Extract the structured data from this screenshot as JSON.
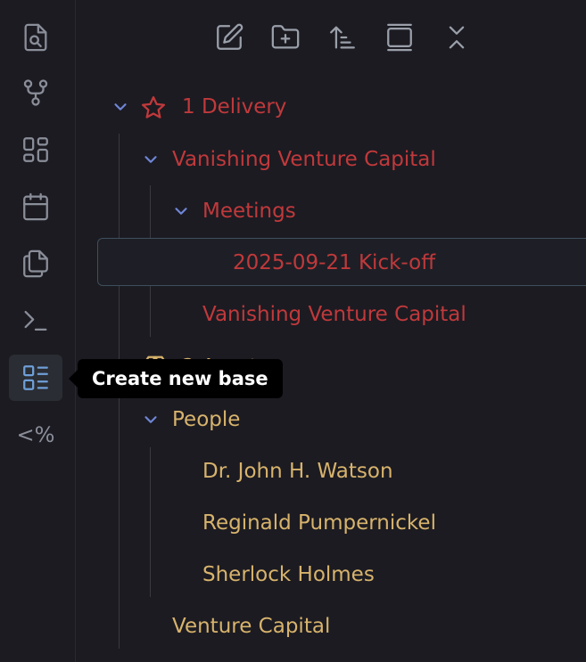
{
  "ribbon": {
    "icons": [
      {
        "name": "search-file-icon"
      },
      {
        "name": "graph-view-icon"
      },
      {
        "name": "canvas-icon"
      },
      {
        "name": "calendar-icon"
      },
      {
        "name": "copy-icon"
      },
      {
        "name": "terminal-icon"
      },
      {
        "name": "create-base-icon"
      },
      {
        "name": "templater-icon",
        "text": "<%"
      }
    ],
    "tooltip": "Create new base"
  },
  "toolbar": {
    "buttons": [
      "new-note",
      "new-folder",
      "sort-order",
      "auto-reveal",
      "collapse-all"
    ]
  },
  "tree": {
    "delivery": "1 Delivery",
    "vvc_folder": "Vanishing Venture Capital",
    "meetings": "Meetings",
    "kickoff": "2025-09-21 Kick-off",
    "vvc_note": "Vanishing Venture Capital",
    "assets": "2 Assets",
    "people": "People",
    "watson": "Dr. John H. Watson",
    "reginald": "Reginald Pumpernickel",
    "sherlock": "Sherlock Holmes",
    "venture_capital": "Venture Capital"
  },
  "colors": {
    "accent": "#6f9fd8",
    "delivery": "#c0393b",
    "assets": "#d7b36c",
    "chevron": "#6f86d6"
  }
}
